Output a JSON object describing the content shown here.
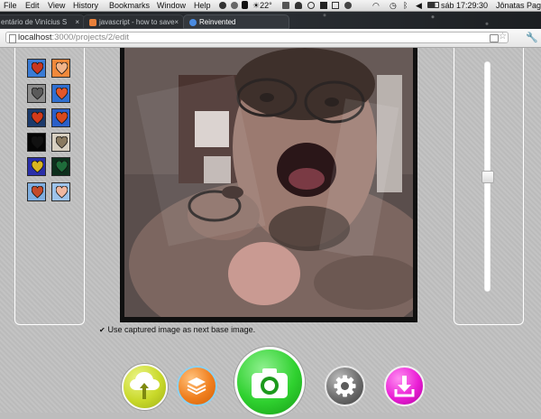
{
  "menubar": {
    "items": [
      "File",
      "Edit",
      "View",
      "History",
      "Bookmarks",
      "Window",
      "Help"
    ],
    "temperature": "22°",
    "clock": "sáb 17:29:30",
    "user": "Jônatas Paga"
  },
  "tabs": [
    {
      "label": "entário de Vinícius S",
      "active": false,
      "close": "×"
    },
    {
      "label": "javascript - how to save",
      "active": false,
      "close": "×"
    },
    {
      "label": "Reinvented",
      "active": true,
      "close": ""
    }
  ],
  "address": {
    "host": "localhost",
    "path": ":3000/projects/2/edit"
  },
  "effects": [
    {
      "icon": "heart-icon",
      "tone": "#c8361f",
      "bg": "#3a7bd5"
    },
    {
      "icon": "heart-icon",
      "tone": "#f2b48a",
      "bg": "#f0883a"
    },
    {
      "icon": "heart-icon",
      "tone": "#5a5a5a",
      "bg": "#8c8c8c"
    },
    {
      "icon": "heart-icon",
      "tone": "#e2572a",
      "bg": "#2f6fd0"
    },
    {
      "icon": "heart-icon",
      "tone": "#d23a1a",
      "bg": "#1c3a6b"
    },
    {
      "icon": "heart-icon",
      "tone": "#d8491e",
      "bg": "#2a5fc8"
    },
    {
      "icon": "heart-icon",
      "tone": "#111111",
      "bg": "#050505"
    },
    {
      "icon": "heart-icon",
      "tone": "#8a7a60",
      "bg": "#d7cfc0"
    },
    {
      "icon": "heart-icon",
      "tone": "#d9b520",
      "bg": "#2a2fa8"
    },
    {
      "icon": "heart-icon",
      "tone": "#1e6c3a",
      "bg": "#0d2f1c"
    },
    {
      "icon": "heart-icon",
      "tone": "#c44a2a",
      "bg": "#7faee0"
    },
    {
      "icon": "heart-icon",
      "tone": "#f0b8a0",
      "bg": "#9dc3ea"
    }
  ],
  "slider": {
    "value": 0.5
  },
  "option": {
    "checkmark": "✔",
    "label": "Use captured image as next base image."
  },
  "actions": [
    {
      "name": "upload-cloud-button",
      "icon": "cloud-upload-icon",
      "color": "#c9d92a"
    },
    {
      "name": "layers-button",
      "icon": "layers-icon",
      "color": "#f07f1e"
    },
    {
      "name": "camera-capture-button",
      "icon": "camera-icon",
      "color": "#2fd12f"
    },
    {
      "name": "settings-button",
      "icon": "gear-icon",
      "color": "#6d6d6d"
    },
    {
      "name": "download-button",
      "icon": "download-icon",
      "color": "#ea1fd5"
    }
  ]
}
